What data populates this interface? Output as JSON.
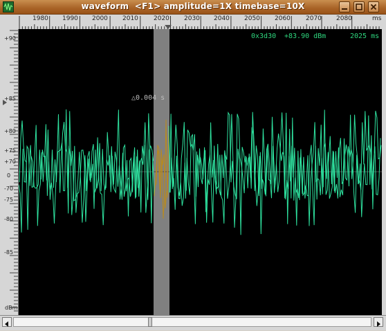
{
  "window": {
    "title": "waveform  <F1> amplitude=1X timebase=10X",
    "controls": [
      "minimize-icon",
      "maximize-icon",
      "close-icon"
    ],
    "accent_color": "#a86226"
  },
  "time_ruler": {
    "labels": [
      "1980",
      "1990",
      "2000",
      "2010",
      "2020",
      "2030",
      "2040",
      "2050",
      "2060",
      "2070",
      "2080"
    ],
    "unit": "ms"
  },
  "amplitude_axis": {
    "labels": [
      "+90",
      "+85",
      "+80",
      "+75",
      "+70",
      "0",
      "-70",
      "-75",
      "-80",
      "-85"
    ],
    "unit": "dBm"
  },
  "readout": {
    "offset": "0x3d30",
    "level": "+83.90 dBm",
    "time": "2025 ms"
  },
  "marker": {
    "delta_label": "△0.004 s"
  },
  "colors": {
    "trace": "#2fe3a0",
    "trace_in_selection": "#b88a1f",
    "selection_band": "#808080",
    "background": "#000000"
  }
}
